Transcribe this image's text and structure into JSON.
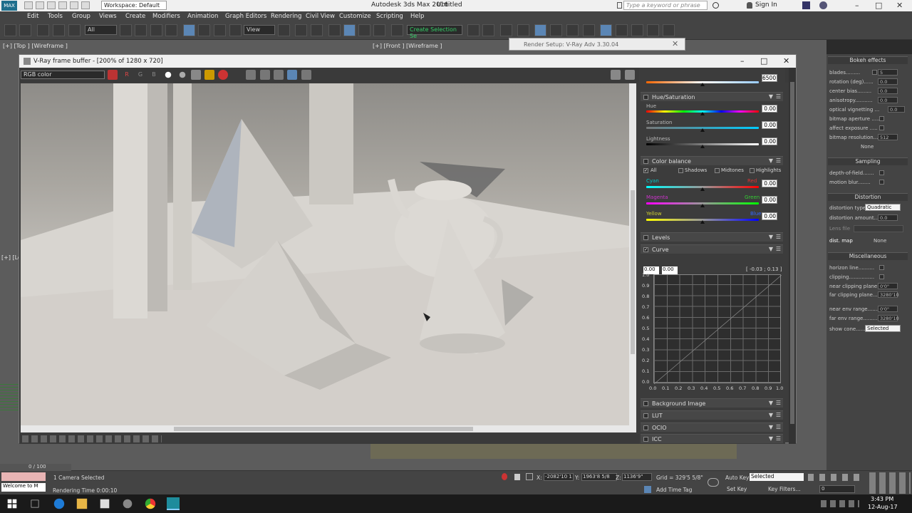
{
  "app": {
    "title": "Autodesk 3ds Max 2016",
    "file": "Untitled",
    "workspace": "Workspace: Default",
    "search_placeholder": "Type a keyword or phrase",
    "sign_in": "Sign In"
  },
  "menu": [
    "Edit",
    "Tools",
    "Group",
    "Views",
    "Create",
    "Modifiers",
    "Animation",
    "Graph Editors",
    "Rendering",
    "Civil View",
    "Customize",
    "Scripting",
    "Help"
  ],
  "toolbar": {
    "selection_filter": "All",
    "ref_coord": "View",
    "named_selection": "Create Selection Se"
  },
  "viewports": {
    "top": "[+] [Top ] [Wireframe ]",
    "front": "[+] [Front ] [Wireframe ]",
    "left": "[+] [Le"
  },
  "render_setup": {
    "title": "Render Setup: V-Ray Adv 3.30.04"
  },
  "vfb": {
    "title": "V-Ray frame buffer - [200% of 1280 x 720]",
    "channel": "RGB color",
    "channel_buttons": [
      "R",
      "G",
      "B"
    ],
    "white_balance_value": "6500",
    "hue_saturation": {
      "label": "Hue/Saturation",
      "hue_label": "Hue",
      "hue": "0.00",
      "saturation_label": "Saturation",
      "saturation": "0.00",
      "lightness_label": "Lightness",
      "lightness": "0.00"
    },
    "color_balance": {
      "label": "Color balance",
      "modes": [
        "All",
        "Shadows",
        "Midtones",
        "Highlights"
      ],
      "cyan": "Cyan",
      "red": "Red",
      "cyan_red": "0.00",
      "magenta": "Magenta",
      "green": "Green",
      "magenta_green": "0.00",
      "yellow": "Yellow",
      "blue": "Blue",
      "yellow_blue": "0.00"
    },
    "levels": "Levels",
    "curve": {
      "label": "Curve",
      "in": "0.00",
      "out": "0.00",
      "readout": "[ -0.03 ; 0.13 ]",
      "y_ticks": [
        "1.0",
        "0.9",
        "0.8",
        "0.7",
        "0.6",
        "0.5",
        "0.4",
        "0.3",
        "0.2",
        "0.1",
        "0.0"
      ],
      "x_ticks": [
        "0.0",
        "0.1",
        "0.2",
        "0.3",
        "0.4",
        "0.5",
        "0.6",
        "0.7",
        "0.8",
        "0.9",
        "1.0"
      ]
    },
    "lower_rollouts": [
      "Background Image",
      "LUT",
      "OCIO",
      "ICC"
    ]
  },
  "command_panel": {
    "bokeh": {
      "header": "Bokeh effects",
      "rows": [
        {
          "label": "blades.........",
          "value": "5"
        },
        {
          "label": "rotation (deg)......",
          "value": "0.0"
        },
        {
          "label": "center bias.........",
          "value": "0.0"
        },
        {
          "label": "anisotropy...........",
          "value": "0.0"
        },
        {
          "label": "optical vignetting ...",
          "value": "0.0"
        }
      ],
      "bitmap_aperture": "bitmap aperture .....",
      "affect_exposure": "affect exposure .....",
      "bitmap_resolution": "bitmap resolution.....",
      "bitmap_resolution_value": "512",
      "none": "None"
    },
    "sampling": {
      "header": "Sampling",
      "dof": "depth-of-field.......",
      "motion_blur": "motion blur........"
    },
    "distortion": {
      "header": "Distortion",
      "type_label": "distortion type",
      "type_value": "Quadratic",
      "amount_label": "distortion amount...",
      "amount_value": "0.0",
      "lens_file": "Lens file",
      "dist_map": "dist. map",
      "none": "None"
    },
    "misc": {
      "header": "Miscellaneous",
      "horizon": "horizon line..........",
      "clipping": "clipping................",
      "near_clip": "near clipping plane...",
      "near_clip_value": "0'0\"",
      "far_clip": "far clipping plane....",
      "far_clip_value": "3280'10",
      "near_env": "near env range........",
      "near_env_value": "0'0\"",
      "far_env": "far env range..........",
      "far_env_value": "3280'10",
      "show_cone": "show cone.......",
      "show_cone_value": "Selected"
    }
  },
  "status": {
    "frame": "0 / 100",
    "maxscript": "Welcome to M",
    "selection": "1 Camera Selected",
    "render_time": "Rendering Time  0:00:10",
    "x_label": "X:",
    "x": "-2082'10 1",
    "y_label": "Y:",
    "y": "1963'8 5/8",
    "z_label": "Z:",
    "z": "1136'9\"",
    "grid": "Grid = 329'5 5/8\"",
    "add_time_tag": "Add Time Tag",
    "auto_key": "Auto Key",
    "set_key": "Set Key",
    "key_mode": "Selected",
    "key_filters": "Key Filters...",
    "frame_field": "0"
  },
  "clock": {
    "time": "3:43 PM",
    "date": "12-Aug-17"
  },
  "colors": {
    "accent": "#5b86b5",
    "panel": "#3c3c3c",
    "dark": "#2a2a2a"
  }
}
